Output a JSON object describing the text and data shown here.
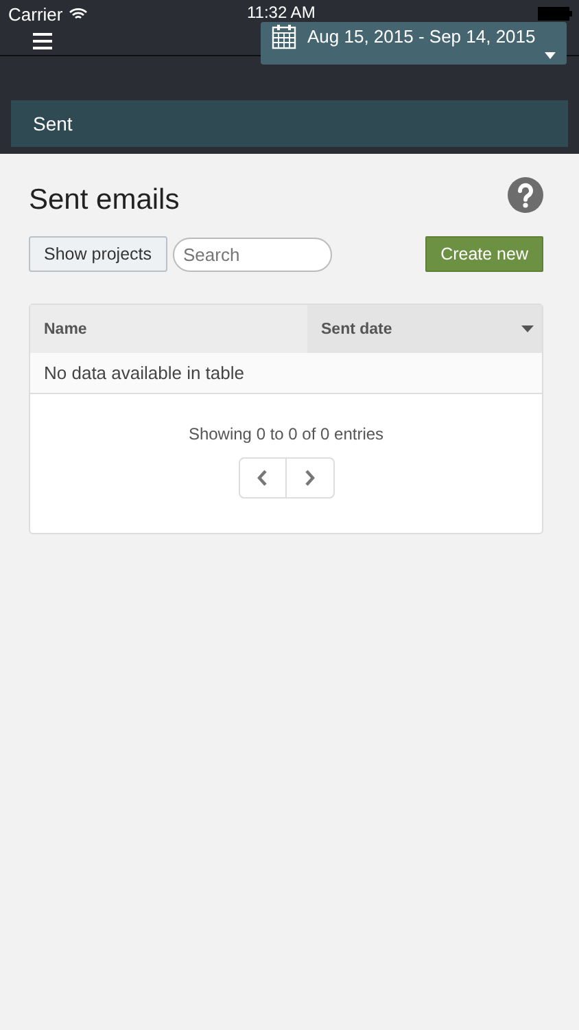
{
  "status_bar": {
    "carrier": "Carrier",
    "time": "11:32 AM"
  },
  "date_range": {
    "label": "Aug 15, 2015 - Sep 14, 2015"
  },
  "breadcrumb": "Sent",
  "page": {
    "title": "Sent emails"
  },
  "toolbar": {
    "show_projects": "Show projects",
    "search": {
      "placeholder": "Search"
    },
    "create": "Create new"
  },
  "table": {
    "columns": [
      {
        "label": "Name",
        "sorted": false
      },
      {
        "label": "Sent date",
        "sorted": true
      }
    ],
    "empty_message": "No data available in table",
    "info": "Showing 0 to 0 of 0 entries"
  }
}
